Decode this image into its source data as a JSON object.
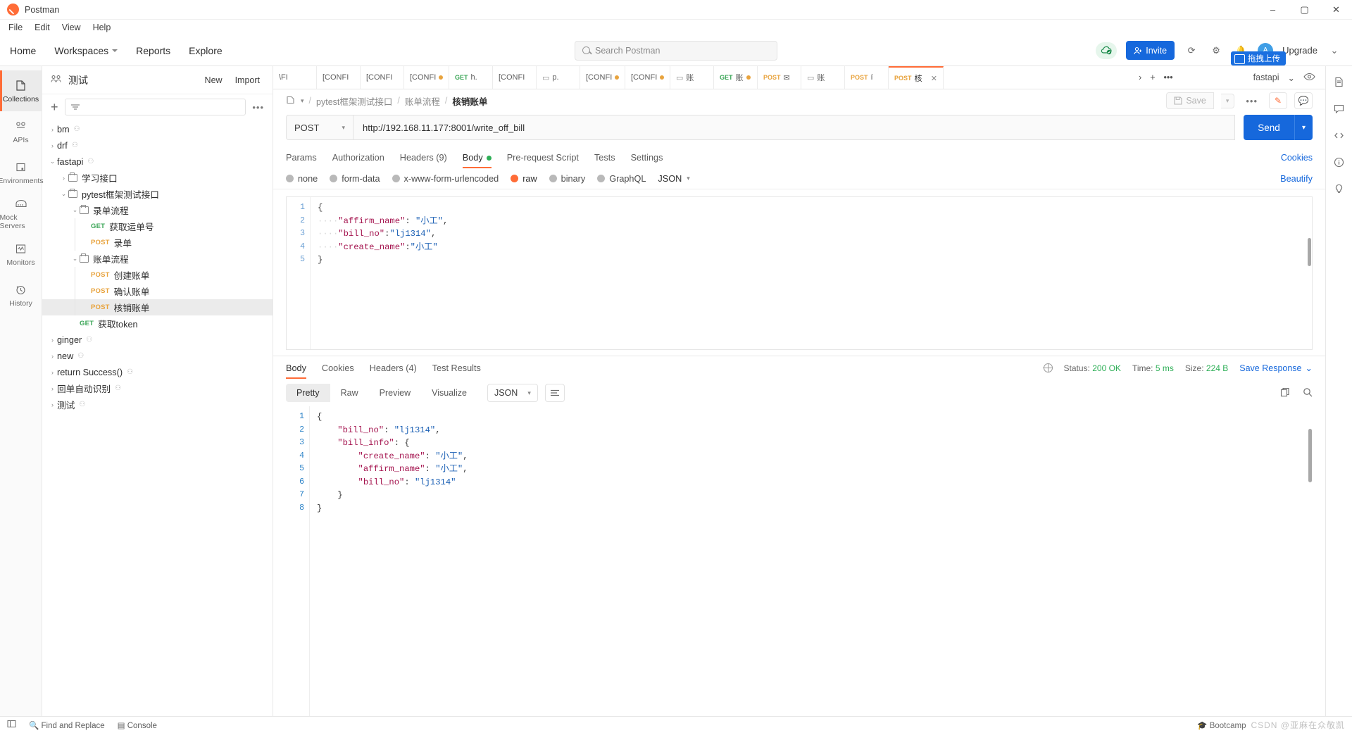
{
  "window": {
    "title": "Postman",
    "minimize": "–",
    "maximize": "▢",
    "close": "✕"
  },
  "menu": [
    "File",
    "Edit",
    "View",
    "Help"
  ],
  "nav": {
    "home": "Home",
    "workspaces": "Workspaces",
    "reports": "Reports",
    "explore": "Explore",
    "search_placeholder": "Search Postman",
    "invite": "Invite",
    "upgrade": "Upgrade",
    "upload_badge": "拖拽上传"
  },
  "rail": [
    {
      "label": "Collections",
      "icon": "collections-icon"
    },
    {
      "label": "APIs",
      "icon": "apis-icon"
    },
    {
      "label": "Environments",
      "icon": "environments-icon"
    },
    {
      "label": "Mock Servers",
      "icon": "mock-servers-icon"
    },
    {
      "label": "Monitors",
      "icon": "monitors-icon"
    },
    {
      "label": "History",
      "icon": "history-icon"
    }
  ],
  "sidebar": {
    "workspace": "测试",
    "new_button": "New",
    "import_button": "Import",
    "more": "•••",
    "tree": [
      {
        "label": "bm",
        "depth": 0,
        "chev": "›",
        "shared": true
      },
      {
        "label": "drf",
        "depth": 0,
        "chev": "›",
        "shared": true
      },
      {
        "label": "fastapi",
        "depth": 0,
        "chev": "⌄",
        "shared": true
      },
      {
        "label": "学习接口",
        "depth": 1,
        "chev": "›",
        "folder": true
      },
      {
        "label": "pytest框架测试接口",
        "depth": 1,
        "chev": "⌄",
        "folder": true
      },
      {
        "label": "录单流程",
        "depth": 2,
        "chev": "⌄",
        "folder": true
      },
      {
        "label": "获取运单号",
        "depth": 3,
        "verb": "GET"
      },
      {
        "label": "录单",
        "depth": 3,
        "verb": "POST"
      },
      {
        "label": "账单流程",
        "depth": 2,
        "chev": "⌄",
        "folder": true
      },
      {
        "label": "创建账单",
        "depth": 3,
        "verb": "POST"
      },
      {
        "label": "确认账单",
        "depth": 3,
        "verb": "POST"
      },
      {
        "label": "核销账单",
        "depth": 3,
        "verb": "POST",
        "selected": true
      },
      {
        "label": "获取token",
        "depth": 2,
        "verb": "GET"
      },
      {
        "label": "ginger",
        "depth": 0,
        "chev": "›",
        "shared": true
      },
      {
        "label": "new",
        "depth": 0,
        "chev": "›",
        "shared": true
      },
      {
        "label": "return Success()",
        "depth": 0,
        "chev": "›",
        "shared": true
      },
      {
        "label": "回单自动识别",
        "depth": 0,
        "chev": "›",
        "shared": true
      },
      {
        "label": "测试",
        "depth": 0,
        "chev": "›",
        "shared": true
      }
    ]
  },
  "tabs": [
    {
      "label": "\\FI",
      "verb": "",
      "dot": false
    },
    {
      "label": "[CONFI",
      "verb": "",
      "dot": false
    },
    {
      "label": "[CONFI",
      "verb": "",
      "dot": false
    },
    {
      "label": "[CONFI",
      "verb": "",
      "dot": true
    },
    {
      "label": "h.",
      "verb": "GET",
      "dot": false
    },
    {
      "label": "[CONFI",
      "verb": "",
      "dot": false
    },
    {
      "label": "p.",
      "verb": "",
      "dot": false,
      "folder": true
    },
    {
      "label": "[CONFI",
      "verb": "",
      "dot": true
    },
    {
      "label": "[CONFI",
      "verb": "",
      "dot": true
    },
    {
      "label": "账",
      "verb": "",
      "dot": false,
      "folder": true
    },
    {
      "label": "账",
      "verb": "GET",
      "dot": true
    },
    {
      "label": "✉",
      "verb": "POST",
      "dot": false
    },
    {
      "label": "账",
      "verb": "",
      "dot": false,
      "folder": true
    },
    {
      "label": "í",
      "verb": "POST",
      "dot": false
    },
    {
      "label": "核",
      "verb": "POST",
      "dot": false,
      "active": true
    }
  ],
  "tabbar": {
    "next": "›",
    "plus": "+",
    "more": "•••",
    "environment": "fastapi",
    "env_caret": "⌄",
    "eye": "eye-icon"
  },
  "breadcrumb": {
    "collection": "pytest框架测试接口",
    "folder": "账单流程",
    "request": "核销账单",
    "sep": "/"
  },
  "request": {
    "save_label": "Save",
    "method": "POST",
    "url": "http://192.168.11.177:8001/write_off_bill",
    "send_label": "Send",
    "tabs": [
      {
        "label": "Params"
      },
      {
        "label": "Authorization"
      },
      {
        "label": "Headers (9)"
      },
      {
        "label": "Body",
        "active": true,
        "dot": true
      },
      {
        "label": "Pre-request Script"
      },
      {
        "label": "Tests"
      },
      {
        "label": "Settings"
      }
    ],
    "cookies_link": "Cookies",
    "body_types": [
      {
        "label": "none",
        "on": false
      },
      {
        "label": "form-data",
        "on": false
      },
      {
        "label": "x-www-form-urlencoded",
        "on": false
      },
      {
        "label": "raw",
        "on": true
      },
      {
        "label": "binary",
        "on": false
      },
      {
        "label": "GraphQL",
        "on": false
      }
    ],
    "format": "JSON",
    "format_caret": "⌄",
    "beautify": "Beautify",
    "body_lines": [
      "1",
      "2",
      "3",
      "4",
      "5"
    ],
    "body_code": [
      {
        "parts": [
          {
            "t": "{",
            "c": "p"
          }
        ]
      },
      {
        "parts": [
          {
            "t": "····",
            "c": "ind"
          },
          {
            "t": "\"affirm_name\"",
            "c": "k"
          },
          {
            "t": ": ",
            "c": "p"
          },
          {
            "t": "\"小工\"",
            "c": "s"
          },
          {
            "t": ",",
            "c": "p"
          }
        ]
      },
      {
        "parts": [
          {
            "t": "····",
            "c": "ind"
          },
          {
            "t": "\"bill_no\"",
            "c": "k"
          },
          {
            "t": ":",
            "c": "p"
          },
          {
            "t": "\"lj1314\"",
            "c": "s"
          },
          {
            "t": ",",
            "c": "p"
          }
        ]
      },
      {
        "parts": [
          {
            "t": "····",
            "c": "ind"
          },
          {
            "t": "\"create_name\"",
            "c": "k"
          },
          {
            "t": ":",
            "c": "p"
          },
          {
            "t": "\"小工\"",
            "c": "s"
          }
        ]
      },
      {
        "parts": [
          {
            "t": "}",
            "c": "p"
          }
        ]
      }
    ]
  },
  "response": {
    "tabs": [
      {
        "label": "Body",
        "active": true
      },
      {
        "label": "Cookies"
      },
      {
        "label": "Headers (4)"
      },
      {
        "label": "Test Results"
      }
    ],
    "status_label": "Status:",
    "status_value": "200 OK",
    "time_label": "Time:",
    "time_value": "5 ms",
    "size_label": "Size:",
    "size_value": "224 B",
    "save_response": "Save Response",
    "save_caret": "⌄",
    "views": [
      {
        "label": "Pretty",
        "on": true
      },
      {
        "label": "Raw",
        "on": false
      },
      {
        "label": "Preview",
        "on": false
      },
      {
        "label": "Visualize",
        "on": false
      }
    ],
    "format": "JSON",
    "format_caret": "⌄",
    "lines": [
      "1",
      "2",
      "3",
      "4",
      "5",
      "6",
      "7",
      "8"
    ],
    "code": [
      {
        "parts": [
          {
            "t": "{",
            "c": "p"
          }
        ]
      },
      {
        "parts": [
          {
            "t": "    ",
            "c": "p"
          },
          {
            "t": "\"bill_no\"",
            "c": "k"
          },
          {
            "t": ": ",
            "c": "p"
          },
          {
            "t": "\"lj1314\"",
            "c": "s"
          },
          {
            "t": ",",
            "c": "p"
          }
        ]
      },
      {
        "parts": [
          {
            "t": "    ",
            "c": "p"
          },
          {
            "t": "\"bill_info\"",
            "c": "k"
          },
          {
            "t": ": {",
            "c": "p"
          }
        ]
      },
      {
        "parts": [
          {
            "t": "        ",
            "c": "p"
          },
          {
            "t": "\"create_name\"",
            "c": "k"
          },
          {
            "t": ": ",
            "c": "p"
          },
          {
            "t": "\"小工\"",
            "c": "s"
          },
          {
            "t": ",",
            "c": "p"
          }
        ]
      },
      {
        "parts": [
          {
            "t": "        ",
            "c": "p"
          },
          {
            "t": "\"affirm_name\"",
            "c": "k"
          },
          {
            "t": ": ",
            "c": "p"
          },
          {
            "t": "\"小工\"",
            "c": "s"
          },
          {
            "t": ",",
            "c": "p"
          }
        ]
      },
      {
        "parts": [
          {
            "t": "        ",
            "c": "p"
          },
          {
            "t": "\"bill_no\"",
            "c": "k"
          },
          {
            "t": ": ",
            "c": "p"
          },
          {
            "t": "\"lj1314\"",
            "c": "s"
          }
        ]
      },
      {
        "parts": [
          {
            "t": "    }",
            "c": "p"
          }
        ]
      },
      {
        "parts": [
          {
            "t": "}",
            "c": "p"
          }
        ]
      }
    ]
  },
  "footer": {
    "layout_icon": "layout-icon",
    "find_replace": "Find and Replace",
    "console": "Console",
    "bootcamp": "Bootcamp",
    "watermark": "CSDN @亚麻在众敬凯"
  },
  "colors": {
    "accent": "#ff6c37",
    "blue": "#1668dc",
    "get": "#3aa556",
    "post": "#e8a33d",
    "green": "#2eaf57"
  }
}
